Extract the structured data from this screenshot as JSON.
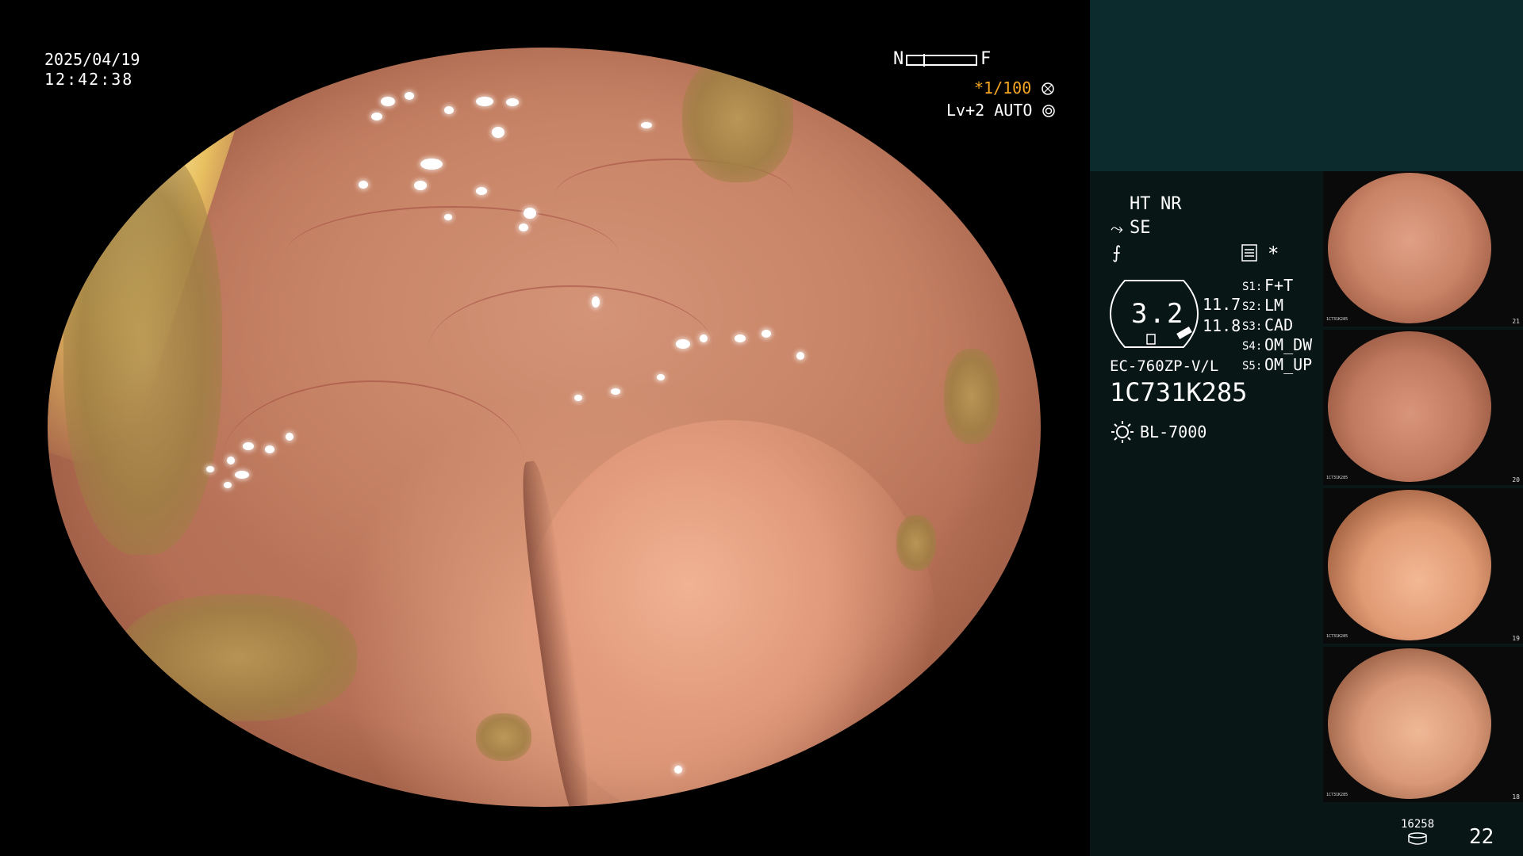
{
  "overlay": {
    "date": "2025/04/19",
    "time": "12:42:38",
    "nf_left": "N",
    "nf_right": "F",
    "shutter_prefix": "*",
    "shutter": "1/100",
    "level": "Lv+2",
    "iris": "AUTO"
  },
  "panel": {
    "ht": "HT",
    "nr": "NR",
    "se": "SE",
    "lens_value": "3.2",
    "val_a": "11.7",
    "val_b": "11.8",
    "star": "*",
    "scope_model": "EC-760ZP-V/L",
    "scope_serial": "1C731K285",
    "light_source": "BL-7000",
    "softkeys": [
      {
        "key": "S1:",
        "value": "F+T"
      },
      {
        "key": "S2:",
        "value": "LM"
      },
      {
        "key": "S3:",
        "value": "CAD"
      },
      {
        "key": "S4:",
        "value": "OM_DW"
      },
      {
        "key": "S5:",
        "value": "OM_UP"
      }
    ]
  },
  "thumbnails": [
    {
      "index": 1,
      "num": "21",
      "serial": "1C731K285"
    },
    {
      "index": 2,
      "num": "20",
      "serial": "1C731K285"
    },
    {
      "index": 3,
      "num": "19",
      "serial": "1C731K285"
    },
    {
      "index": 4,
      "num": "18",
      "serial": "1C731K285"
    }
  ],
  "footer": {
    "storage_count": "16258",
    "image_count": "22"
  },
  "colors": {
    "accent_orange": "#f5a623",
    "panel_top": "#0b2b2d",
    "panel_body": "#081616"
  }
}
